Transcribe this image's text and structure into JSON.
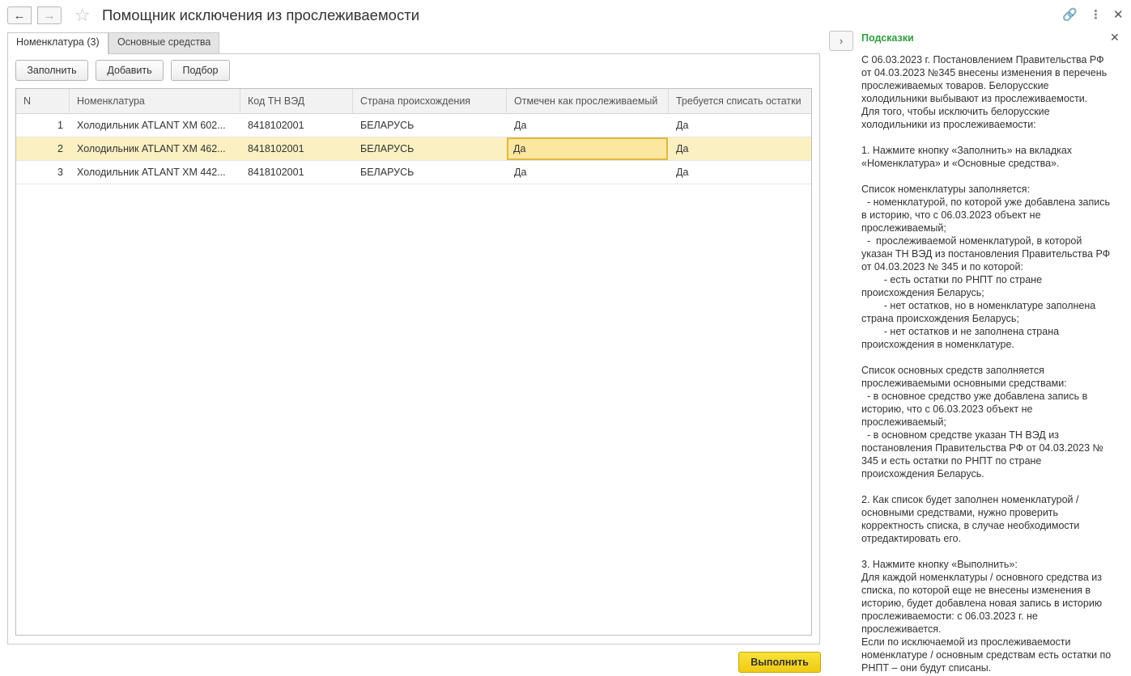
{
  "window": {
    "title": "Помощник исключения из прослеживаемости",
    "back_icon": "←",
    "forward_icon": "→",
    "favorite_icon": "☆",
    "link_icon": "🔗",
    "more_icon": "⋮",
    "close_icon": "✕"
  },
  "tabs": [
    {
      "label": "Номенклатура (3)",
      "active": true
    },
    {
      "label": "Основные средства",
      "active": false
    }
  ],
  "toolbar": {
    "fill_label": "Заполнить",
    "add_label": "Добавить",
    "pick_label": "Подбор"
  },
  "table": {
    "columns": [
      "N",
      "Номенклатура",
      "Код ТН ВЭД",
      "Страна происхождения",
      "Отмечен как прослеживаемый",
      "Требуется списать остатки"
    ],
    "rows": [
      {
        "n": "1",
        "item": "Холодильник ATLANT ХМ 602...",
        "code": "8418102001",
        "country": "БЕЛАРУСЬ",
        "traceable": "Да",
        "writeoff": "Да"
      },
      {
        "n": "2",
        "item": "Холодильник ATLANT ХМ 462...",
        "code": "8418102001",
        "country": "БЕЛАРУСЬ",
        "traceable": "Да",
        "writeoff": "Да"
      },
      {
        "n": "3",
        "item": "Холодильник ATLANT ХМ 442...",
        "code": "8418102001",
        "country": "БЕЛАРУСЬ",
        "traceable": "Да",
        "writeoff": "Да"
      }
    ],
    "selected_row": 2
  },
  "execute_label": "Выполнить",
  "hints": {
    "toggle_icon": "›",
    "title": "Подсказки",
    "close_icon": "✕",
    "text": "С 06.03.2023 г. Постановлением Правительства РФ\nот 04.03.2023 №345 внесены изменения в перечень\nпрослеживаемых товаров. Белорусские\nхолодильники выбывают из прослеживаемости.\nДля того, чтобы исключить белорусские\nхолодильники из прослеживаемости:\n\n1. Нажмите кнопку «Заполнить» на вкладках\n«Номенклатура» и «Основные средства».\n\nСписок номенклатуры заполняется:\n  - номенклатурой, по которой уже добавлена запись\nв историю, что с 06.03.2023 объект не\nпрослеживаемый;\n  -  прослеживаемой номенклатурой, в которой\nуказан ТН ВЭД из постановления Правительства РФ\nот 04.03.2023 № 345 и по которой:\n        - есть остатки по РНПТ по стране\nпроисхождения Беларусь;\n        - нет остатков, но в номенклатуре заполнена\nстрана происхождения Беларусь;\n        - нет остатков и не заполнена страна\nпроисхождения в номенклатуре.\n\nСписок основных средств заполняется\nпрослеживаемыми основными средствами:\n  - в основное средство уже добавлена запись в\nисторию, что с 06.03.2023 объект не\nпрослеживаемый;\n  - в основном средстве указан ТН ВЭД из\nпостановления Правительства РФ от 04.03.2023 №\n345 и есть остатки по РНПТ по стране\nпроисхождения Беларусь.\n\n2. Как список будет заполнен номенклатурой /\nосновными средствами, нужно проверить\nкорректность списка, в случае необходимости\nотредактировать его.\n\n3. Нажмите кнопку «Выполнить»:\nДля каждой номенклатуры / основного средства из\nсписка, по которой еще не внесены изменения в\nисторию, будет добавлена новая запись в историю\nпрослеживаемости: с 06.03.2023 г. не\nпрослеживается.\nЕсли по исключаемой из прослеживаемости\nноменклатуре / основным средствам есть остатки по\nРНПТ – они будут списаны."
  }
}
